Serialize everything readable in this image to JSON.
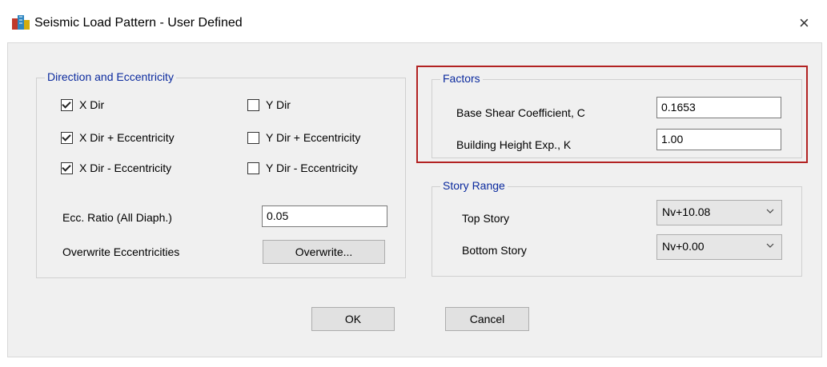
{
  "window": {
    "title": "Seismic Load Pattern - User Defined",
    "close_glyph": "×"
  },
  "direction_group": {
    "title": "Direction and Eccentricity",
    "checkboxes": [
      {
        "label": "X Dir",
        "checked": true
      },
      {
        "label": "Y Dir",
        "checked": false
      },
      {
        "label": "X Dir + Eccentricity",
        "checked": true
      },
      {
        "label": "Y Dir + Eccentricity",
        "checked": false
      },
      {
        "label": "X Dir - Eccentricity",
        "checked": true
      },
      {
        "label": "Y Dir - Eccentricity",
        "checked": false
      }
    ],
    "ecc_ratio_label": "Ecc. Ratio (All Diaph.)",
    "ecc_ratio_value": "0.05",
    "overwrite_label": "Overwrite Eccentricities",
    "overwrite_button": "Overwrite..."
  },
  "factors_group": {
    "title": "Factors",
    "base_shear_label": "Base Shear Coefficient, C",
    "base_shear_value": "0.1653",
    "height_exp_label": "Building Height Exp., K",
    "height_exp_value": "1.00"
  },
  "story_group": {
    "title": "Story Range",
    "top_label": "Top Story",
    "top_value": "Nv+10.08",
    "bottom_label": "Bottom Story",
    "bottom_value": "Nv+0.00"
  },
  "buttons": {
    "ok": "OK",
    "cancel": "Cancel"
  },
  "colors": {
    "group_title": "#0b2a9e",
    "highlight": "#b22222",
    "dialog_bg": "#f0f0f0"
  }
}
